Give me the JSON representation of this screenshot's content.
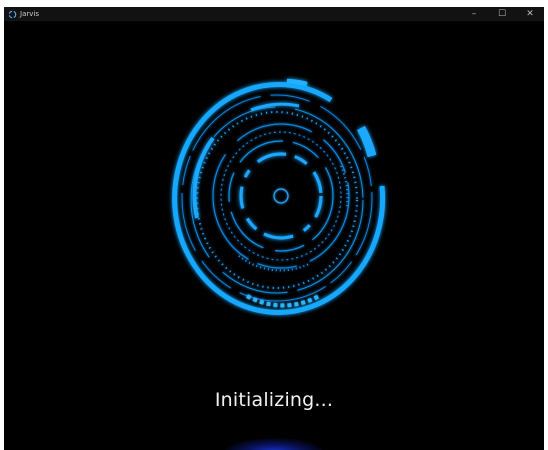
{
  "window": {
    "title": "Jarvis",
    "app_icon": "jarvis-app-icon",
    "controls": {
      "minimize_glyph": "–",
      "maximize_glyph": "☐",
      "close_glyph": "✕"
    }
  },
  "main": {
    "status_text": "Initializing...",
    "accent_color": "#1aa3ff",
    "background_color": "#000000",
    "glow_color": "#1e3cff"
  }
}
